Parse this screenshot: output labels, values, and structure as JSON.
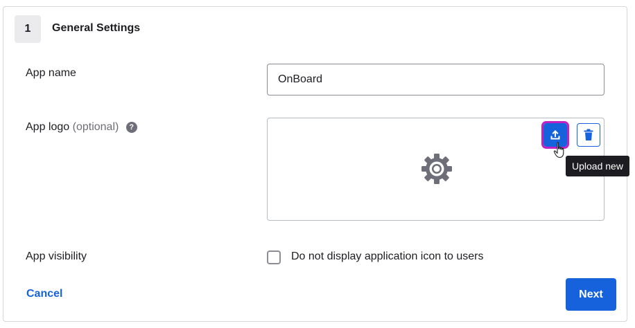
{
  "section": {
    "step_number": "1",
    "title": "General Settings"
  },
  "fields": {
    "app_name": {
      "label": "App name",
      "value": "OnBoard"
    },
    "app_logo": {
      "label": "App logo",
      "optional_text": "(optional)",
      "help_icon": "question-circle-icon",
      "placeholder_icon": "gear-icon",
      "upload_icon": "upload-icon",
      "delete_icon": "trash-icon",
      "tooltip": "Upload new"
    },
    "app_visibility": {
      "label": "App visibility",
      "checkbox_label": "Do not display application icon to users",
      "checked": false
    }
  },
  "actions": {
    "cancel_label": "Cancel",
    "next_label": "Next"
  },
  "colors": {
    "primary": "#1662dd",
    "highlight_outline": "#c21fc4",
    "tooltip_bg": "#1d1d21",
    "gear": "#6e6e78"
  }
}
